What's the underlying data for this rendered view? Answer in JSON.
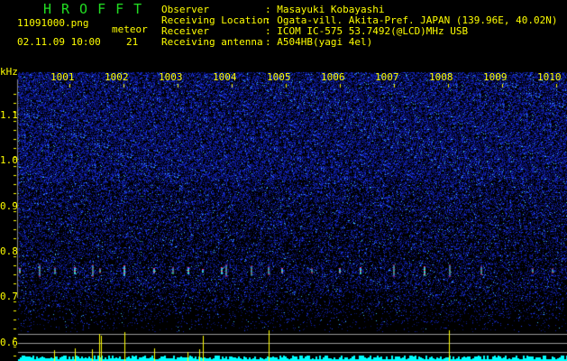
{
  "header": {
    "title": "HROFFT",
    "filename": "11091000.png",
    "datetime": "02.11.09 10:00",
    "meteor_label": "meteor",
    "meteor_count": "21"
  },
  "info": {
    "labels": [
      "Observer",
      "Receiving Location",
      "Receiver",
      "Receiving antenna"
    ],
    "values": [
      ": Masayuki Kobayashi",
      ": Ogata-vill. Akita-Pref. JAPAN (139.96E, 40.02N)",
      ": ICOM IC-575 53.7492(@LCD)MHz USB",
      ": A504HB(yagi 4el)"
    ]
  },
  "axis": {
    "y_unit": "kHz",
    "y_ticks": [
      "1.1",
      "1.0",
      "0.9",
      "0.8",
      "0.7",
      "0.6"
    ],
    "x_ticks": [
      "1001",
      "1002",
      "1003",
      "1004",
      "1005",
      "1006",
      "1007",
      "1008",
      "1009",
      "1010"
    ]
  },
  "colors": {
    "text": "#ffff00",
    "title": "#22dd22",
    "noise": "#1020c0",
    "histogram": "#00ffff",
    "meteor_bar": "#ffff00"
  }
}
